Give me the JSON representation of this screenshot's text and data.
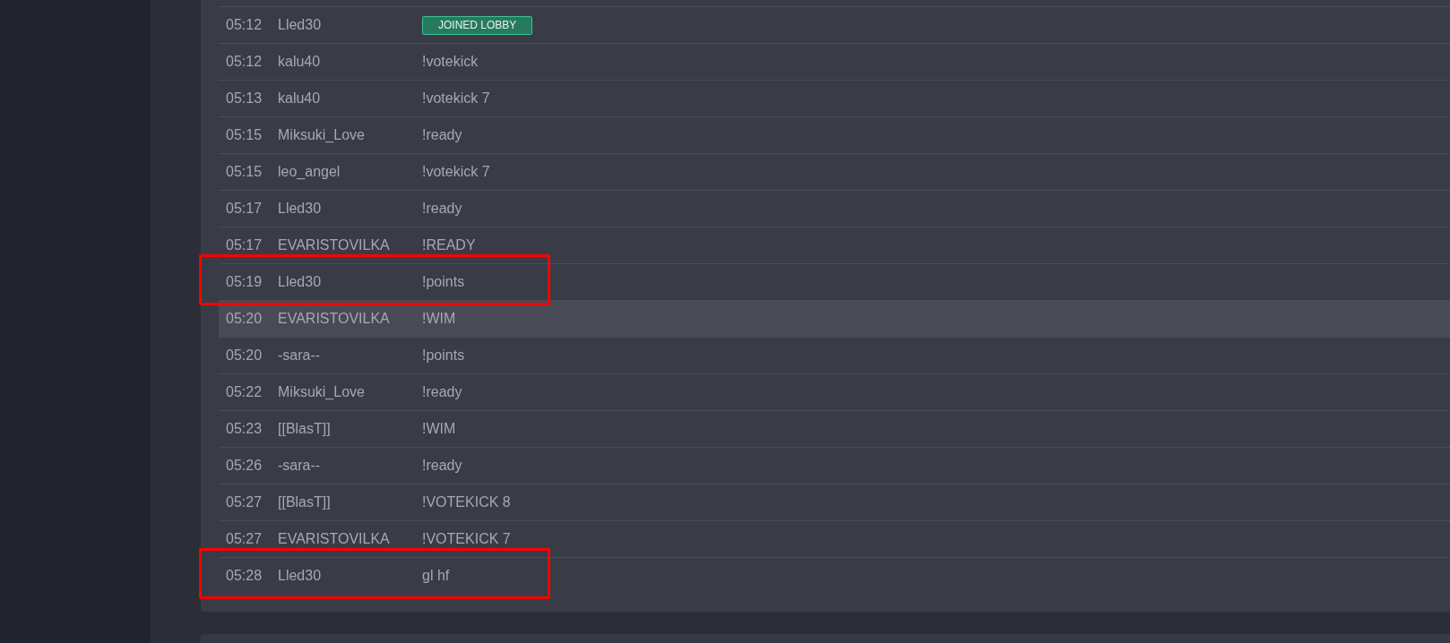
{
  "chat_log": {
    "messages": [
      {
        "time": "05:12",
        "user": "Lled30",
        "kind": "event",
        "text": "JOINED LOBBY",
        "highlighted": false,
        "annotated": false
      },
      {
        "time": "05:12",
        "user": "kalu40",
        "kind": "message",
        "text": "!votekick",
        "highlighted": false,
        "annotated": false
      },
      {
        "time": "05:13",
        "user": "kalu40",
        "kind": "message",
        "text": "!votekick 7",
        "highlighted": false,
        "annotated": false
      },
      {
        "time": "05:15",
        "user": "Miksuki_Love",
        "kind": "message",
        "text": "!ready",
        "highlighted": false,
        "annotated": false
      },
      {
        "time": "05:15",
        "user": "leo_angel",
        "kind": "message",
        "text": "!votekick 7",
        "highlighted": false,
        "annotated": false
      },
      {
        "time": "05:17",
        "user": "Lled30",
        "kind": "message",
        "text": "!ready",
        "highlighted": false,
        "annotated": false
      },
      {
        "time": "05:17",
        "user": "EVARISTOVILKA",
        "kind": "message",
        "text": "!READY",
        "highlighted": false,
        "annotated": false
      },
      {
        "time": "05:19",
        "user": "Lled30",
        "kind": "message",
        "text": "!points",
        "highlighted": false,
        "annotated": true
      },
      {
        "time": "05:20",
        "user": "EVARISTOVILKA",
        "kind": "message",
        "text": "!WIM",
        "highlighted": true,
        "annotated": false
      },
      {
        "time": "05:20",
        "user": "-sara--",
        "kind": "message",
        "text": "!points",
        "highlighted": false,
        "annotated": false
      },
      {
        "time": "05:22",
        "user": "Miksuki_Love",
        "kind": "message",
        "text": "!ready",
        "highlighted": false,
        "annotated": false
      },
      {
        "time": "05:23",
        "user": "[[BlasT]]",
        "kind": "message",
        "text": "!WIM",
        "highlighted": false,
        "annotated": false
      },
      {
        "time": "05:26",
        "user": "-sara--",
        "kind": "message",
        "text": "!ready",
        "highlighted": false,
        "annotated": false
      },
      {
        "time": "05:27",
        "user": "[[BlasT]]",
        "kind": "message",
        "text": "!VOTEKICK 8",
        "highlighted": false,
        "annotated": false
      },
      {
        "time": "05:27",
        "user": "EVARISTOVILKA",
        "kind": "message",
        "text": "!VOTEKICK 7",
        "highlighted": false,
        "annotated": false
      },
      {
        "time": "05:28",
        "user": "Lled30",
        "kind": "message",
        "text": "gl hf",
        "highlighted": false,
        "annotated": true
      }
    ]
  }
}
